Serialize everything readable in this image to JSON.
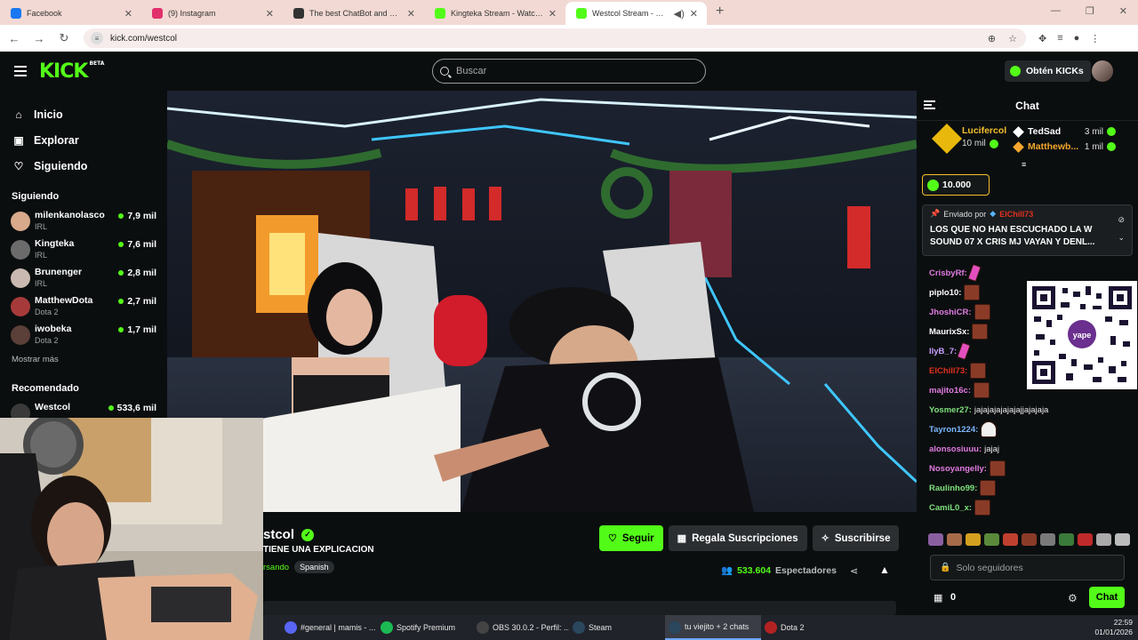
{
  "browser": {
    "tabs": [
      {
        "label": "Facebook",
        "color": "#1877f2"
      },
      {
        "label": "(9) Instagram",
        "color": "#e1306c"
      },
      {
        "label": "The best ChatBot and Widgets",
        "color": "#333333"
      },
      {
        "label": "Kingteka Stream - Watch Live o",
        "color": "#53fc18"
      },
      {
        "label": "Westcol Stream - Watch Live",
        "color": "#53fc18",
        "active": true
      }
    ],
    "url": "kick.com/westcol"
  },
  "nav": {
    "logo": "KICK",
    "logo_badge": "BETA",
    "search_placeholder": "Buscar",
    "kicks_button": "Obtén KICKs"
  },
  "sidebar": {
    "main": [
      {
        "label": "Inicio",
        "icon": "home-icon"
      },
      {
        "label": "Explorar",
        "icon": "browse-icon"
      },
      {
        "label": "Siguiendo",
        "icon": "heart-icon"
      }
    ],
    "following_title": "Siguiendo",
    "following": [
      {
        "name": "milenkanolasco",
        "category": "IRL",
        "viewers": "7,9 mil",
        "color": "#d8a98a"
      },
      {
        "name": "Kingteka",
        "category": "IRL",
        "viewers": "7,6 mil",
        "color": "#6b6b6b"
      },
      {
        "name": "Brunenger",
        "category": "IRL",
        "viewers": "2,8 mil",
        "color": "#c9b9b0"
      },
      {
        "name": "MatthewDota",
        "category": "Dota 2",
        "viewers": "2,7 mil",
        "color": "#a63a3a"
      },
      {
        "name": "iwobeka",
        "category": "Dota 2",
        "viewers": "1,7 mil",
        "color": "#5a4038"
      }
    ],
    "show_more": "Mostrar más",
    "recommended_title": "Recomendado",
    "recommended": [
      {
        "name": "Westcol",
        "viewers": "533,6 mil"
      }
    ]
  },
  "stream": {
    "name_visible": "stcol",
    "title_visible": "TIENE UNA EXPLICACION",
    "category_visible": "rsando",
    "language": "Spanish",
    "follow": "Seguir",
    "gift_subs": "Regala Suscripciones",
    "subscribe": "Suscribirse",
    "viewers": "533.604",
    "viewers_label": "Espectadores"
  },
  "chat": {
    "title": "Chat",
    "top_gifter": {
      "name": "Lucifercol",
      "amount": "10 mil"
    },
    "gifters": [
      {
        "name": "TedSad",
        "amount": "3 mil",
        "color": "#ffffff"
      },
      {
        "name": "Matthewb...",
        "amount": "1 mil",
        "color": "#f4a62e"
      }
    ],
    "kicks_pill": "10.000",
    "pinned": {
      "sent_by": "Enviado por",
      "user": "ElChill73",
      "message": "LOS QUE NO HAN ESCUCHADO LA W SOUND 07 X CRIS MJ VAYAN Y DENL..."
    },
    "messages": [
      {
        "user": "CrisbyRf:",
        "color": "#e07be0",
        "text": "",
        "emote": "pink"
      },
      {
        "user": "piplo10:",
        "color": "#ffffff",
        "text": "",
        "emote": "brown"
      },
      {
        "user": "JhoshiCR:",
        "color": "#e07be0",
        "text": "",
        "emote": "brown"
      },
      {
        "user": "MaurixSx:",
        "color": "#ffffff",
        "text": "",
        "emote": "brown"
      },
      {
        "user": "IlyB_7:",
        "color": "#c9a0ff",
        "text": "",
        "emote": "pink"
      },
      {
        "user": "ElChill73:",
        "color": "#e0301e",
        "text": "",
        "emote": "brown"
      },
      {
        "user": "majito16c:",
        "color": "#e07be0",
        "text": "",
        "emote": "brown"
      },
      {
        "user": "Yosmer27:",
        "color": "#7de07b",
        "text": "jajajajajajajajjajajaja",
        "emote": ""
      },
      {
        "user": "Tayron1224:",
        "color": "#7bb8ff",
        "text": "",
        "emote": "ghost"
      },
      {
        "user": "alonsosiuuu:",
        "color": "#e07be0",
        "text": "jajaj",
        "emote": ""
      },
      {
        "user": "Nosoyangelly:",
        "color": "#e07be0",
        "text": "",
        "emote": "brown"
      },
      {
        "user": "Raulinho99:",
        "color": "#7de07b",
        "text": "",
        "emote": "brown"
      },
      {
        "user": "CamiL0_x:",
        "color": "#7de07b",
        "text": "",
        "emote": "brown"
      }
    ],
    "input_placeholder": "Solo seguidores",
    "points": "0",
    "send": "Chat"
  },
  "taskbar": {
    "items": [
      {
        "label": "#general | mamis - ...",
        "color": "#5865f2"
      },
      {
        "label": "Spotify Premium",
        "color": "#1db954"
      },
      {
        "label": "OBS 30.0.2 - Perfil: ...",
        "color": "#444444"
      },
      {
        "label": "Steam",
        "color": "#1b2838"
      },
      {
        "label": "tu viejito + 2 chats",
        "color": "#1b2838",
        "active": true
      },
      {
        "label": "Dota 2",
        "color": "#b22222"
      }
    ],
    "time": "22:59",
    "date": "01/01/2026"
  }
}
